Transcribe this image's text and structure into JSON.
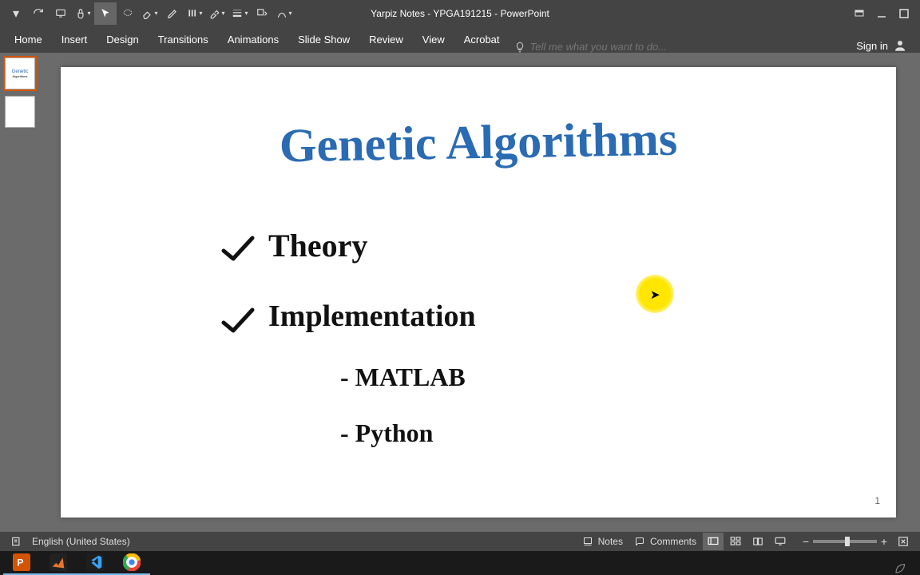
{
  "window_title": "Yarpiz Notes - YPGA191215 - PowerPoint",
  "ribbon": {
    "tabs": [
      "Home",
      "Insert",
      "Design",
      "Transitions",
      "Animations",
      "Slide Show",
      "Review",
      "View",
      "Acrobat"
    ],
    "active_index": 0,
    "tell_me_placeholder": "Tell me what you want to do...",
    "sign_in": "Sign in"
  },
  "slide": {
    "title": "Genetic Algorithms",
    "topic1": "Theory",
    "topic2": "Implementation",
    "sub1": "- MATLAB",
    "sub2": "- Python",
    "page_number": "1"
  },
  "status": {
    "language": "English (United States)",
    "notes": "Notes",
    "comments": "Comments"
  },
  "thumbnails": {
    "thumb1_line1": "Genetic",
    "thumb1_line2": "Algorithms"
  }
}
